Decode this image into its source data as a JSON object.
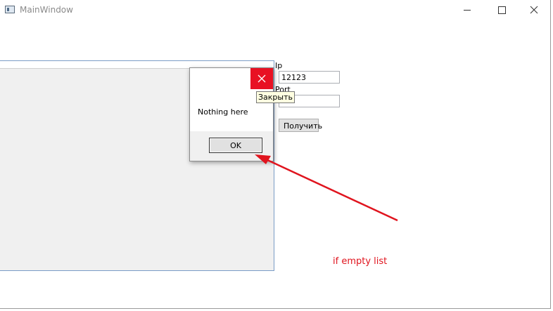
{
  "window": {
    "title": "MainWindow",
    "icons": {
      "app": "app-window-icon",
      "minimize": "minimize-icon",
      "maximize": "maximize-icon",
      "close": "close-icon"
    }
  },
  "form": {
    "ip_label": "Ip",
    "ip_value": "12123",
    "port_label": "Port",
    "port_value": "",
    "get_button_label": "Получить"
  },
  "messagebox": {
    "text": "Nothing here",
    "ok_label": "OK",
    "close_tooltip": "Закрыть",
    "close_icon": "close-icon",
    "close_color": "#e81123"
  },
  "annotation": {
    "text": "if empty list",
    "color": "#e0141e"
  }
}
